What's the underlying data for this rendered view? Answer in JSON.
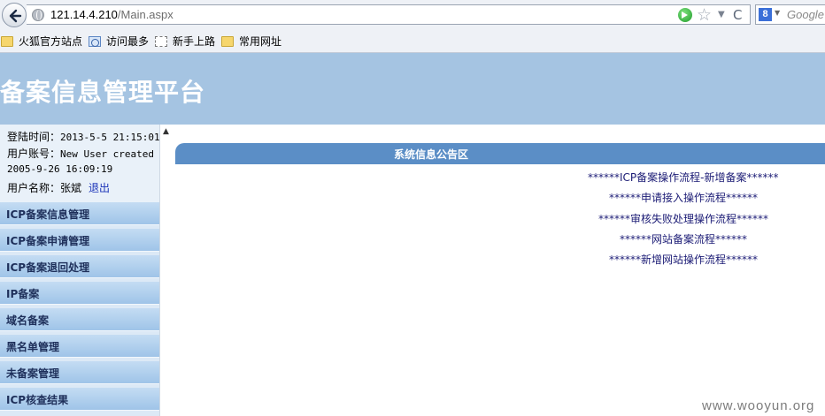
{
  "browser": {
    "url_host": "121.14.4.210",
    "url_path": "/Main.aspx",
    "search_placeholder": "Google",
    "search_engine_icon": "8",
    "bookmarks": [
      {
        "label": "火狐官方站点",
        "icon": "folder-icon"
      },
      {
        "label": "访问最多",
        "icon": "page-icon"
      },
      {
        "label": "新手上路",
        "icon": "dashed-page-icon"
      },
      {
        "label": "常用网址",
        "icon": "folder-icon"
      }
    ]
  },
  "header": {
    "title": "备案信息管理平台"
  },
  "user_info": {
    "login_time_label": "登陆时间：",
    "login_time": "2013-5-5 21:15:01",
    "account_label": "用户账号：",
    "account": "New User created",
    "created_date": "2005-9-26 16:09:19",
    "name_label": "用户名称：",
    "name": "张斌",
    "logout": "退出"
  },
  "menu": [
    "ICP备案信息管理",
    "ICP备案申请管理",
    "ICP备案退回处理",
    "IP备案",
    "域名备案",
    "黑名单管理",
    "未备案管理",
    "ICP核查结果"
  ],
  "notice": {
    "title": "系统信息公告区",
    "links": [
      "******ICP备案操作流程-新增备案******",
      "******申请接入操作流程******",
      "******审核失败处理操作流程******",
      "******网站备案流程******",
      "******新增网站操作流程******"
    ]
  },
  "watermark": "www.wooyun.org",
  "colors": {
    "banner": "#a5c4e2",
    "notice_header": "#5b8ec6",
    "menu_item": "#b3d1ee",
    "link": "#1b1b75"
  }
}
